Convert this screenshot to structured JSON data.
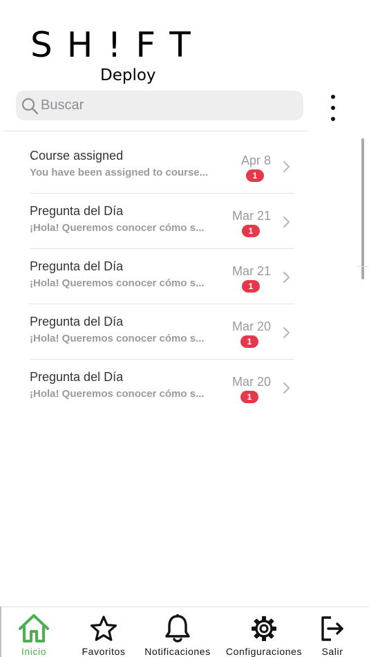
{
  "logo": {
    "main": "SH!FT",
    "sub": "Deploy"
  },
  "search": {
    "placeholder": "Buscar"
  },
  "messages": [
    {
      "title": "Course assigned",
      "subtitle": "You have been assigned to course...",
      "date": "Apr 8",
      "badge": "1"
    },
    {
      "title": "Pregunta del Día",
      "subtitle": "¡Hola! Queremos conocer cómo s...",
      "date": "Mar 21",
      "badge": "1"
    },
    {
      "title": "Pregunta del Día",
      "subtitle": "¡Hola! Queremos conocer cómo s...",
      "date": "Mar 21",
      "badge": "1"
    },
    {
      "title": "Pregunta del Día",
      "subtitle": "¡Hola! Queremos conocer cómo s...",
      "date": "Mar 20",
      "badge": "1"
    },
    {
      "title": "Pregunta del Día",
      "subtitle": "¡Hola! Queremos conocer cómo s...",
      "date": "Mar 20",
      "badge": "1"
    }
  ],
  "tabs": [
    {
      "label": "Inicio",
      "icon": "home-icon",
      "active": true
    },
    {
      "label": "Favoritos",
      "icon": "star-icon",
      "active": false
    },
    {
      "label": "Notificaciones",
      "icon": "bell-icon",
      "active": false
    },
    {
      "label": "Configuraciones",
      "icon": "gear-icon",
      "active": false
    },
    {
      "label": "Salir",
      "icon": "logout-icon",
      "active": false
    }
  ],
  "colors": {
    "accent": "#4caf50",
    "badge": "#e5384a",
    "search_bg": "#eeeeef",
    "secondary_text": "#9a9a9e"
  }
}
